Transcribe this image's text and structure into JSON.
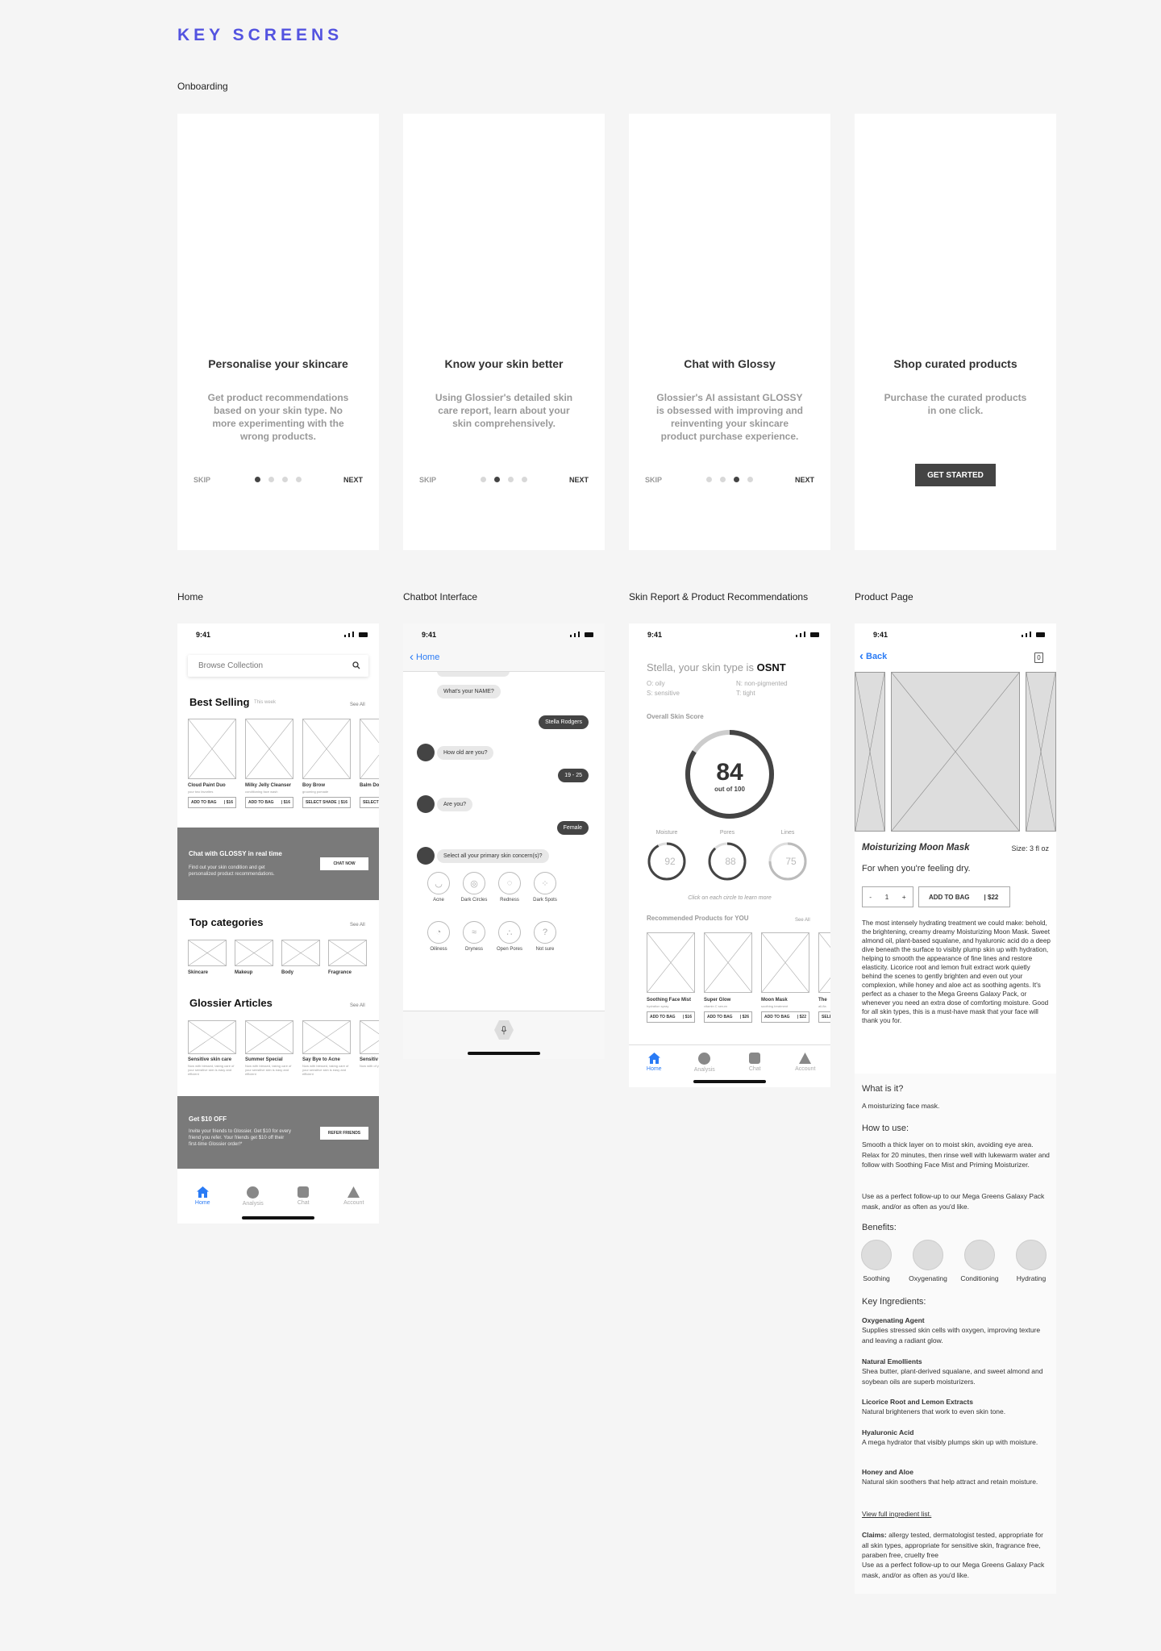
{
  "page_title": "KEY SCREENS",
  "sections": {
    "onboarding": "Onboarding",
    "home": "Home",
    "chatbot": "Chatbot Interface",
    "skin_report": "Skin Report & Product Recommendations",
    "product_page": "Product Page"
  },
  "onboarding": [
    {
      "title": "Personalise your skincare",
      "desc": "Get product recommendations based on your skin type. No more experimenting with the wrong products.",
      "skip": "SKIP",
      "next": "NEXT"
    },
    {
      "title": "Know your skin better",
      "desc": "Using Glossier's detailed skin care report, learn about your skin comprehensively.",
      "skip": "SKIP",
      "next": "NEXT"
    },
    {
      "title": "Chat with Glossy",
      "desc": "Glossier's AI assistant GLOSSY is obsessed with improving and reinventing your skincare product purchase experience.",
      "skip": "SKIP",
      "next": "NEXT"
    },
    {
      "title": "Shop curated products",
      "desc": "Purchase the curated products in one click.",
      "cta": "GET STARTED"
    }
  ],
  "status_time": "9:41",
  "home": {
    "search_placeholder": "Browse Collection",
    "best_selling": {
      "title": "Best Selling",
      "sub": "This week",
      "see_all": "See All",
      "items": [
        {
          "name": "Cloud Paint Duo",
          "desc": "your two favorites",
          "btn": "ADD TO BAG",
          "price": "| $16"
        },
        {
          "name": "Milky Jelly Cleanser",
          "desc": "conditioning face wash",
          "btn": "ADD TO BAG",
          "price": "| $16"
        },
        {
          "name": "Boy Brow",
          "desc": "grooming pomade",
          "btn": "SELECT SHADE",
          "price": "| $16"
        },
        {
          "name": "Balm Do",
          "desc": "",
          "btn": "SELECT",
          "price": ""
        }
      ]
    },
    "chat_banner": {
      "title": "Chat with GLOSSY in real time",
      "desc": "Find out your skin condition and get personalized product recommendations.",
      "btn": "CHAT NOW"
    },
    "categories": {
      "title": "Top categories",
      "see_all": "See All",
      "items": [
        "Skincare",
        "Makeup",
        "Body",
        "Fragrance"
      ]
    },
    "articles": {
      "title": "Glossier Articles",
      "see_all": "See All",
      "items": [
        {
          "title": "Sensitive skin care",
          "desc": "Now with blessed, taking care of your sensitive skin is easy and efficient"
        },
        {
          "title": "Summer Special",
          "desc": "Now with blessed, taking care of your sensitive skin is easy and efficient"
        },
        {
          "title": "Say Bye to Acne",
          "desc": "Now with blessed, taking care of your sensitive skin is easy and efficient"
        },
        {
          "title": "Sensitiv",
          "desc": "Now with of your se and effic"
        }
      ]
    },
    "refer": {
      "title": "Get $10 OFF",
      "desc": "Invite your friends to Glossier. Get $10 for every friend you refer. Your friends get $10 off their first-time Glossier order!*",
      "btn": "REFER FRIENDS"
    },
    "nav": [
      "Home",
      "Analysis",
      "Chat",
      "Account"
    ]
  },
  "chat": {
    "back": "Home",
    "msgs": {
      "q_name": "What's your NAME?",
      "a_name": "Stella Rodgers",
      "q_age": "How old are you?",
      "a_age": "19 - 25",
      "q_sex": "Are you?",
      "a_sex": "Female",
      "q_concern": "Select all your primary skin concern(s)?"
    },
    "concerns": [
      "Acne",
      "Dark Circles",
      "Redness",
      "Dark Spots",
      "Oiliness",
      "Dryness",
      "Open Pores",
      "Not sure"
    ],
    "concern_icons": [
      "◡",
      "◎",
      "◌",
      "⁘",
      "◔",
      "≈",
      "∴",
      "?"
    ]
  },
  "report": {
    "title_prefix": "Stella, your skin type is",
    "type": "OSNT",
    "legend": [
      "O: oily",
      "N: non-pigmented",
      "S: sensitive",
      "T: tight"
    ],
    "score_label": "Overall Skin Score",
    "score": "84",
    "score_sub": "out of 100",
    "score_value": 84,
    "metrics": [
      {
        "label": "Moisture",
        "value": "92",
        "frac": 0.92
      },
      {
        "label": "Pores",
        "value": "88",
        "frac": 0.88
      },
      {
        "label": "Lines",
        "value": "75",
        "frac": 0.75
      }
    ],
    "hint": "Click on each circle to learn more",
    "rec_title": "Recommended Products for YOU",
    "see_all": "See All",
    "products": [
      {
        "name": "Soothing Face Mist",
        "desc": "hydration spray",
        "btn": "ADD TO BAG",
        "price": "| $16"
      },
      {
        "name": "Super Glow",
        "desc": "vitamin C serum",
        "btn": "ADD TO BAG",
        "price": "| $26"
      },
      {
        "name": "Moon Mask",
        "desc": "soothing treatment",
        "btn": "ADD TO BAG",
        "price": "| $22"
      },
      {
        "name": "The",
        "desc": "all-fla",
        "btn": "SELE",
        "price": ""
      }
    ],
    "nav": [
      "Home",
      "Analysis",
      "Chat",
      "Account"
    ]
  },
  "product": {
    "back": "Back",
    "bag_count": "0",
    "name": "Moisturizing Moon Mask",
    "size": "Size: 3 fl oz",
    "tagline": "For when you're feeling dry.",
    "qty_minus": "-",
    "qty": "1",
    "qty_plus": "+",
    "add": "ADD TO BAG",
    "price": "| $22",
    "description": "The most intensely hydrating treatment we could make: behold, the brightening, creamy dreamy Moisturizing Moon Mask. Sweet almond oil, plant-based squalane, and hyaluronic acid do a deep dive beneath the surface to visibly plump skin up with hydration, helping to smooth the appearance of fine lines and restore elasticity. Licorice root and lemon fruit extract work quietly behind the scenes to gently brighten and even out your complexion, while honey and aloe act as soothing agents. It's perfect as a chaser to the Mega Greens Galaxy Pack, or whenever you need an extra dose of comforting moisture. Good for all skin types, this is a must-have mask that your face will thank you for.",
    "what_title": "What is it?",
    "what": "A moisturizing face mask.",
    "how_title": "How to use:",
    "how1": "Smooth a thick layer on to moist skin, avoiding eye area. Relax for 20 minutes, then rinse well with lukewarm water and follow with Soothing Face Mist and Priming Moisturizer.",
    "how2": "Use as a perfect follow-up to our Mega Greens Galaxy Pack mask, and/or as often as you'd like.",
    "benefits_title": "Benefits:",
    "benefits": [
      "Soothing",
      "Oxygenating",
      "Conditioning",
      "Hydrating"
    ],
    "ingredients_title": "Key Ingredients:",
    "ingredients": [
      {
        "name": "Oxygenating Agent",
        "desc": "Supplies stressed skin cells with oxygen, improving texture and leaving a radiant glow."
      },
      {
        "name": "Natural Emollients",
        "desc": "Shea butter, plant-derived squalane, and sweet almond and soybean oils are superb moisturizers."
      },
      {
        "name": "Licorice Root and Lemon Extracts",
        "desc": "Natural brighteners that work to even skin tone."
      },
      {
        "name": "Hyaluronic Acid",
        "desc": "A mega hydrator that visibly plumps skin up with moisture."
      },
      {
        "name": "Honey and Aloe",
        "desc": "Natural skin soothers that help attract and retain moisture."
      }
    ],
    "full_list": "View full ingredient list.",
    "claims_label": "Claims:",
    "claims": "allergy tested, dermatologist tested, appropriate for all skin types, appropriate for sensitive skin, fragrance free, paraben free, cruelty free",
    "claims2": "Use as a perfect follow-up to our Mega Greens Galaxy Pack mask, and/or as often as you'd like."
  },
  "colors": {
    "accent": "#5353e0",
    "ios_blue": "#2a7bf5",
    "dark": "#444444",
    "banner": "#7a7a7a"
  }
}
